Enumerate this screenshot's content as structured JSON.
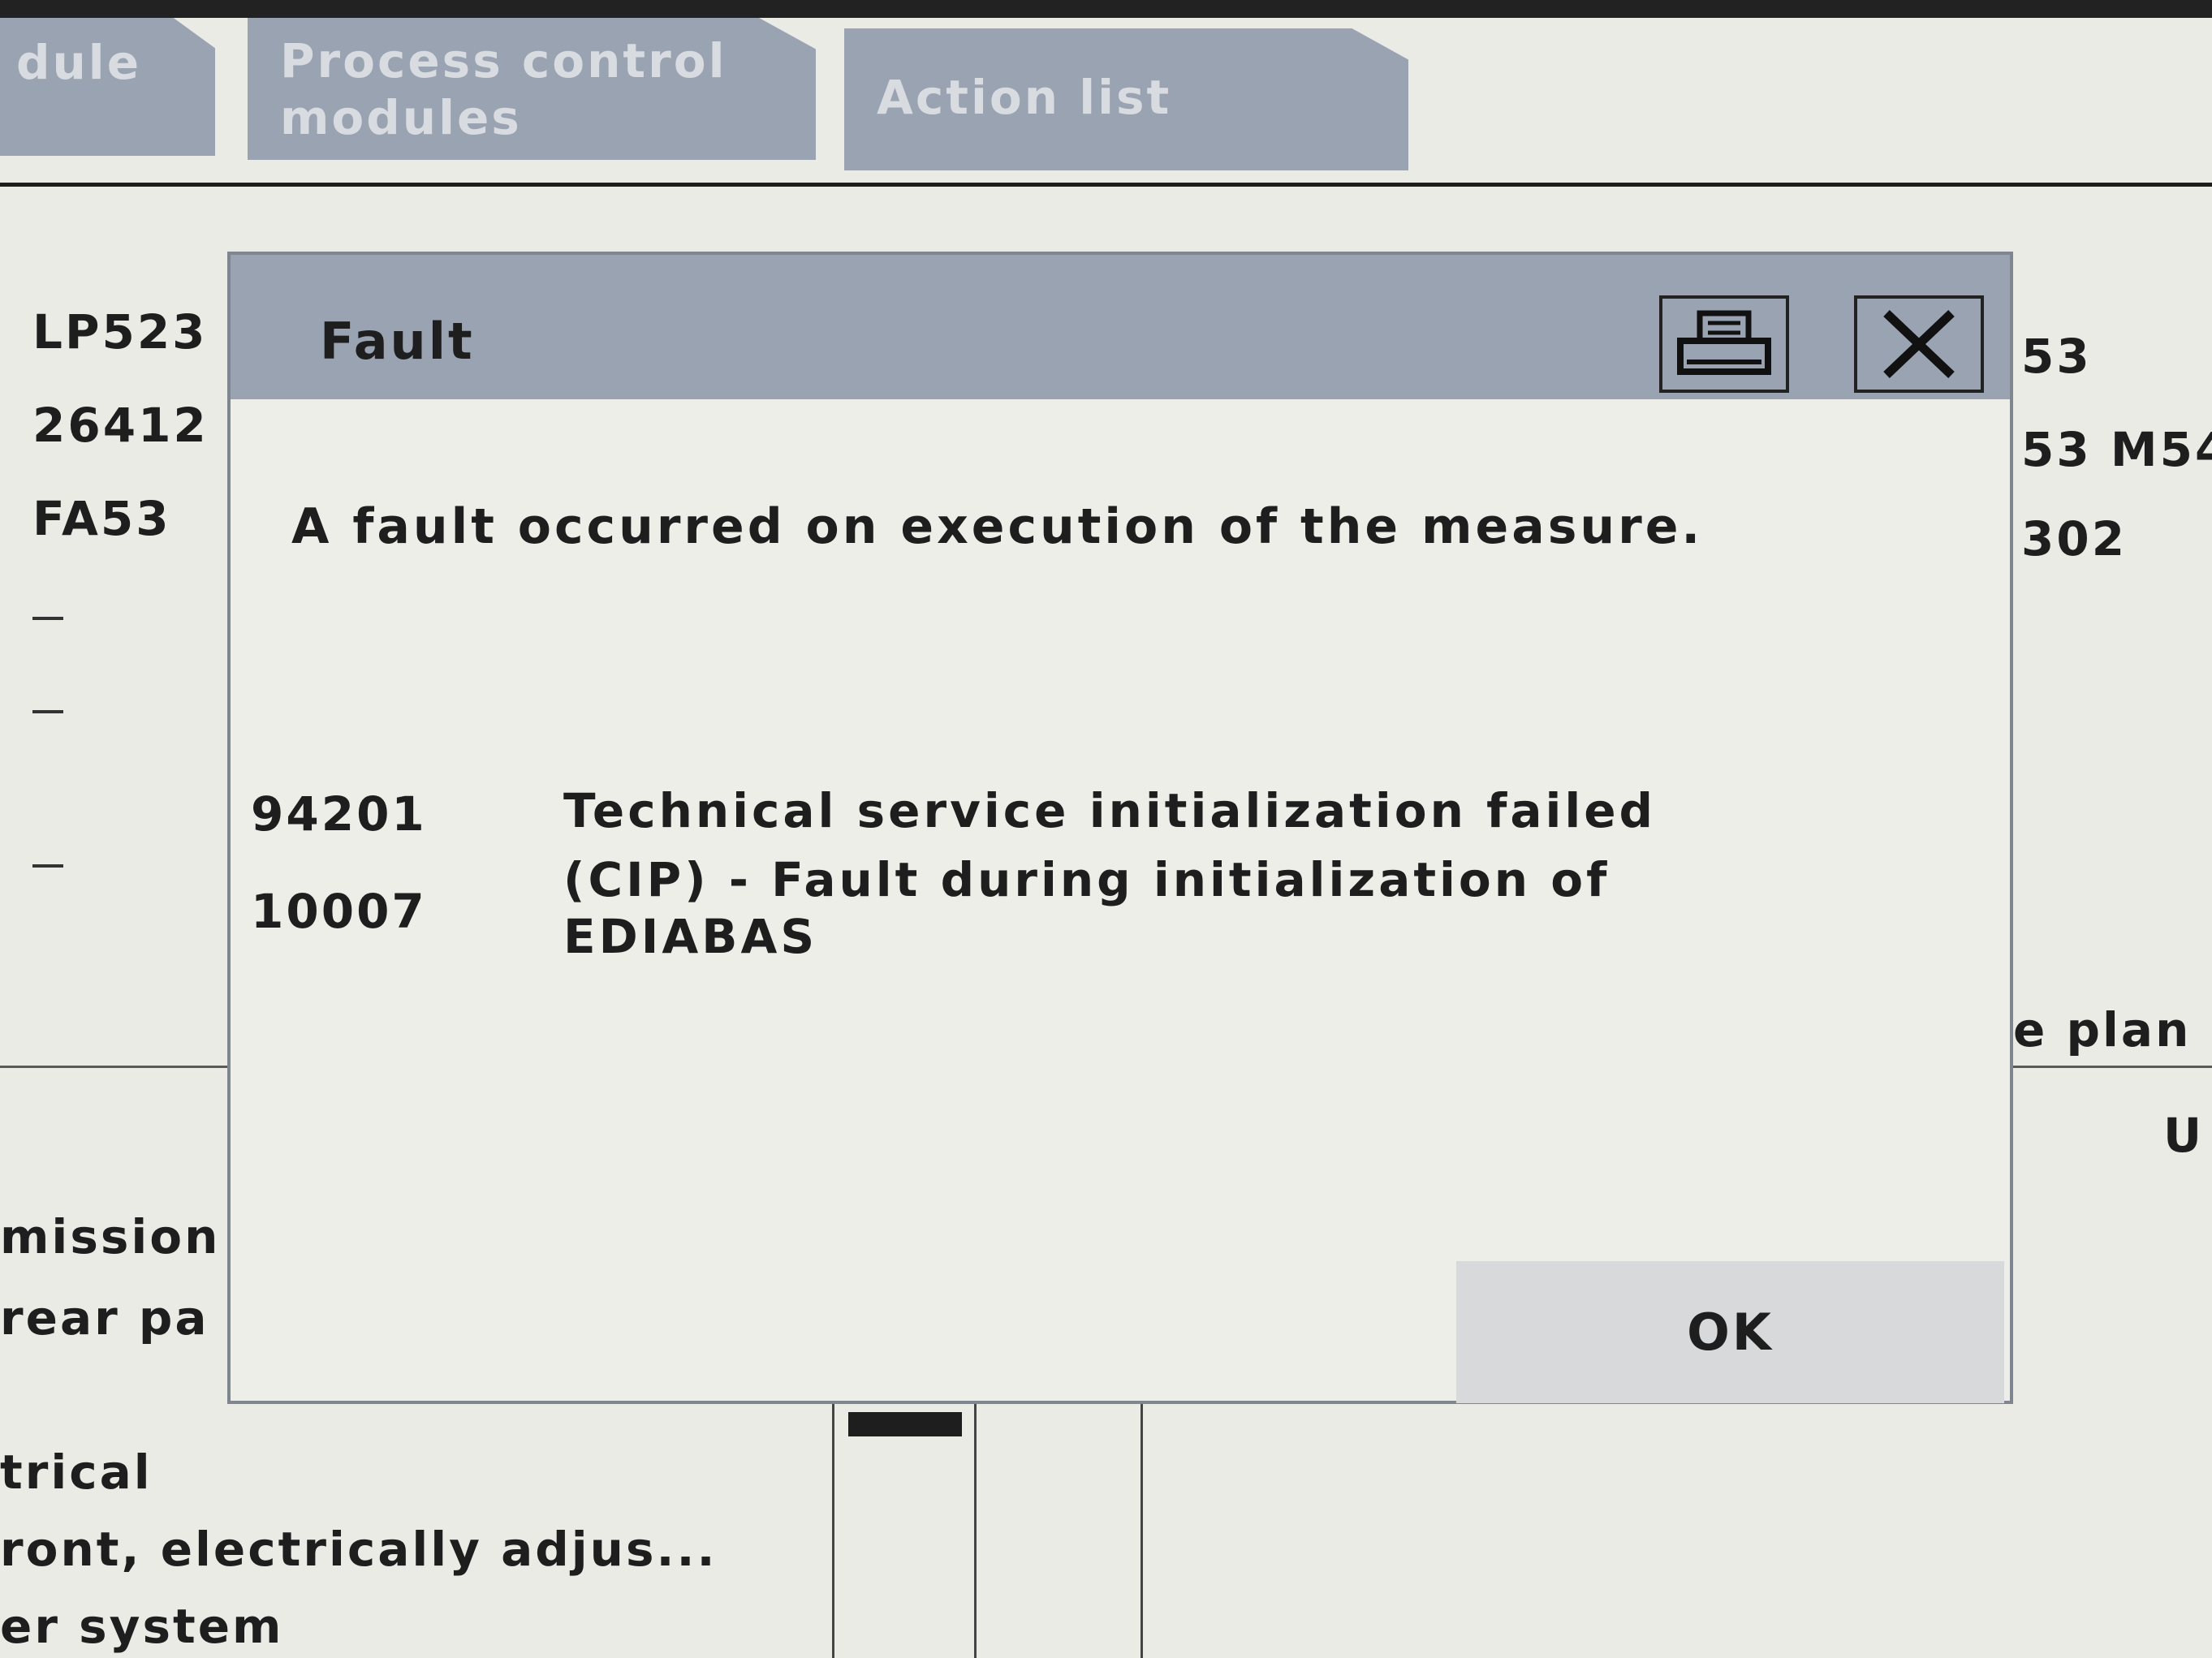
{
  "tabs": [
    {
      "label": "dule"
    },
    {
      "label": "Process control modules"
    },
    {
      "label": "Action list"
    }
  ],
  "background": {
    "left_column": [
      "LP523",
      "26412",
      "FA53"
    ],
    "right_column": [
      "53",
      "53 M54",
      "302"
    ],
    "right_fragments": [
      "e plan",
      "U"
    ],
    "bottom_left": [
      "mission",
      "rear pa",
      "trical",
      "ront, electrically adjus...",
      "er system"
    ]
  },
  "dialog": {
    "title": "Fault",
    "message": "A fault occurred on execution of the measure.",
    "faults": [
      {
        "code": "94201",
        "text": "Technical service initialization failed"
      },
      {
        "code": "10007",
        "text": "(CIP) - Fault during initialization of EDIABAS"
      }
    ],
    "ok_label": "OK"
  },
  "icons": {
    "print": "printer-icon",
    "close": "close-icon"
  }
}
